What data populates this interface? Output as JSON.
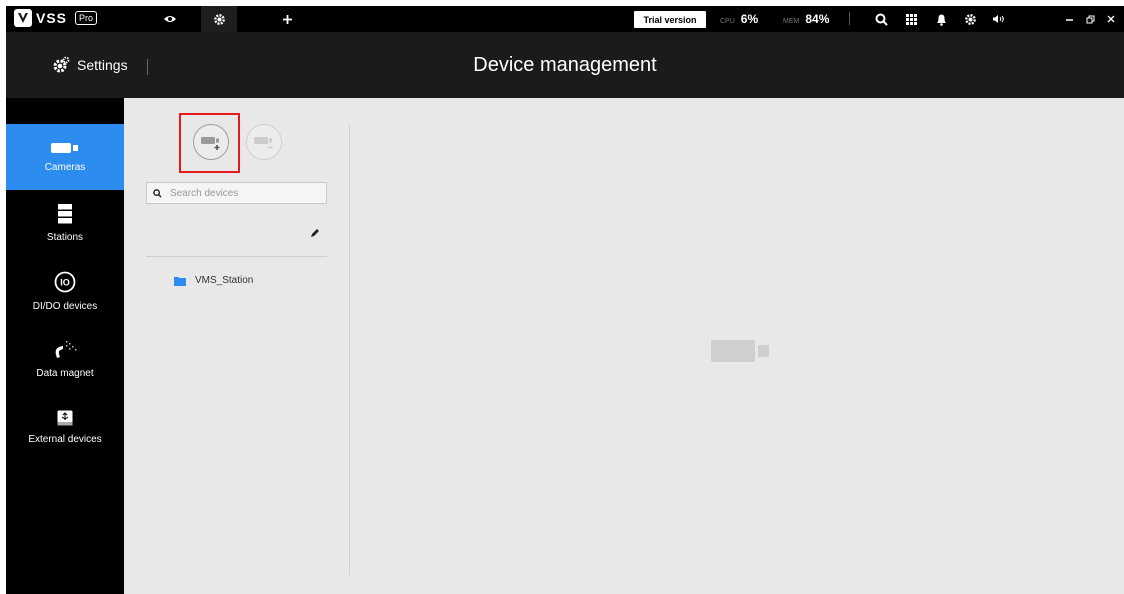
{
  "topbar": {
    "app_name": "VSS",
    "app_badge": "Pro",
    "tabs": [
      {
        "icon": "eye-icon"
      },
      {
        "icon": "gear-icon",
        "active": true
      },
      {
        "icon": "plus-icon"
      }
    ],
    "trial_label": "Trial version",
    "cpu_label": "CPU",
    "cpu_value": "6%",
    "mem_label": "MEM",
    "mem_value": "84%",
    "icons": [
      "search-icon",
      "grid-icon",
      "bell-icon",
      "gear-icon",
      "volume-icon",
      "minimize-icon",
      "restore-icon",
      "close-icon"
    ]
  },
  "header": {
    "settings_label": "Settings",
    "title": "Device management"
  },
  "sidebar": {
    "items": [
      {
        "label": "Cameras",
        "icon": "camera-icon",
        "active": true
      },
      {
        "label": "Stations",
        "icon": "server-icon"
      },
      {
        "label": "DI/DO devices",
        "icon": "io-icon"
      },
      {
        "label": "Data magnet",
        "icon": "magnet-icon"
      },
      {
        "label": "External devices",
        "icon": "usb-drive-icon"
      }
    ]
  },
  "panel": {
    "search_placeholder": "Search devices",
    "tree": [
      {
        "label": "VMS_Station",
        "icon": "folder-icon"
      }
    ]
  },
  "colors": {
    "accent": "#2d8cf0",
    "highlight": "#e41b1b",
    "folder": "#2d8cf0"
  }
}
